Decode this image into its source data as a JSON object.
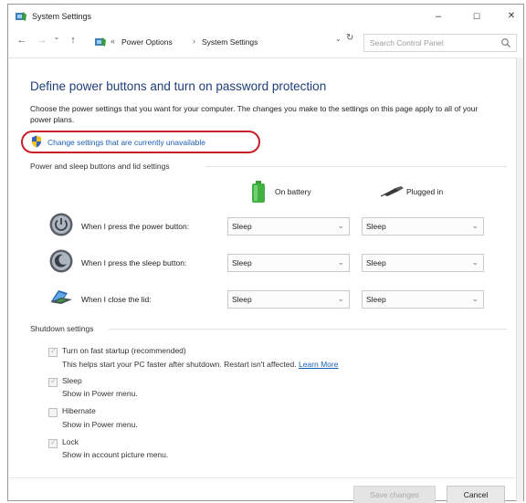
{
  "window": {
    "title": "System Settings",
    "controls": {
      "minimize": "–",
      "maximize": "☐",
      "close": "✕"
    }
  },
  "nav": {
    "back": "←",
    "forward": "→",
    "recent": "⌄",
    "up": "↑"
  },
  "address": {
    "breadcrumbs": [
      "Power Options",
      "System Settings"
    ],
    "separator": "›",
    "prefix_arrow": "«",
    "dropdown": "⌄",
    "refresh": "↻",
    "search_placeholder": "Search Control Panel"
  },
  "page": {
    "heading": "Define power buttons and turn on password protection",
    "description": "Choose the power settings that you want for your computer. The changes you make to the settings on this page apply to all of your power plans.",
    "change_link": "Change settings that are currently unavailable"
  },
  "power_section": {
    "title": "Power and sleep buttons and lid settings",
    "columns": {
      "battery": "On battery",
      "plugged": "Plugged in"
    },
    "rows": [
      {
        "label": "When I press the power button:",
        "battery": "Sleep",
        "plugged": "Sleep",
        "icon": "power-icon"
      },
      {
        "label": "When I press the sleep button:",
        "battery": "Sleep",
        "plugged": "Sleep",
        "icon": "sleep-moon-icon"
      },
      {
        "label": "When I close the lid:",
        "battery": "Sleep",
        "plugged": "Sleep",
        "icon": "laptop-lid-icon"
      }
    ],
    "chevron": "⌄"
  },
  "shutdown_section": {
    "title": "Shutdown settings",
    "items": [
      {
        "label": "Turn on fast startup (recommended)",
        "checked": true,
        "sub": "This helps start your PC faster after shutdown. Restart isn't affected.",
        "link": "Learn More"
      },
      {
        "label": "Sleep",
        "checked": true,
        "sub": "Show in Power menu."
      },
      {
        "label": "Hibernate",
        "checked": false,
        "sub": "Show in Power menu."
      },
      {
        "label": "Lock",
        "checked": true,
        "sub": "Show in account picture menu."
      }
    ],
    "tick": "✓"
  },
  "buttons": {
    "save": "Save changes",
    "cancel": "Cancel"
  },
  "colors": {
    "heading": "#1e3e7a",
    "link": "#1a5fb4",
    "highlight": "#c8202a"
  }
}
